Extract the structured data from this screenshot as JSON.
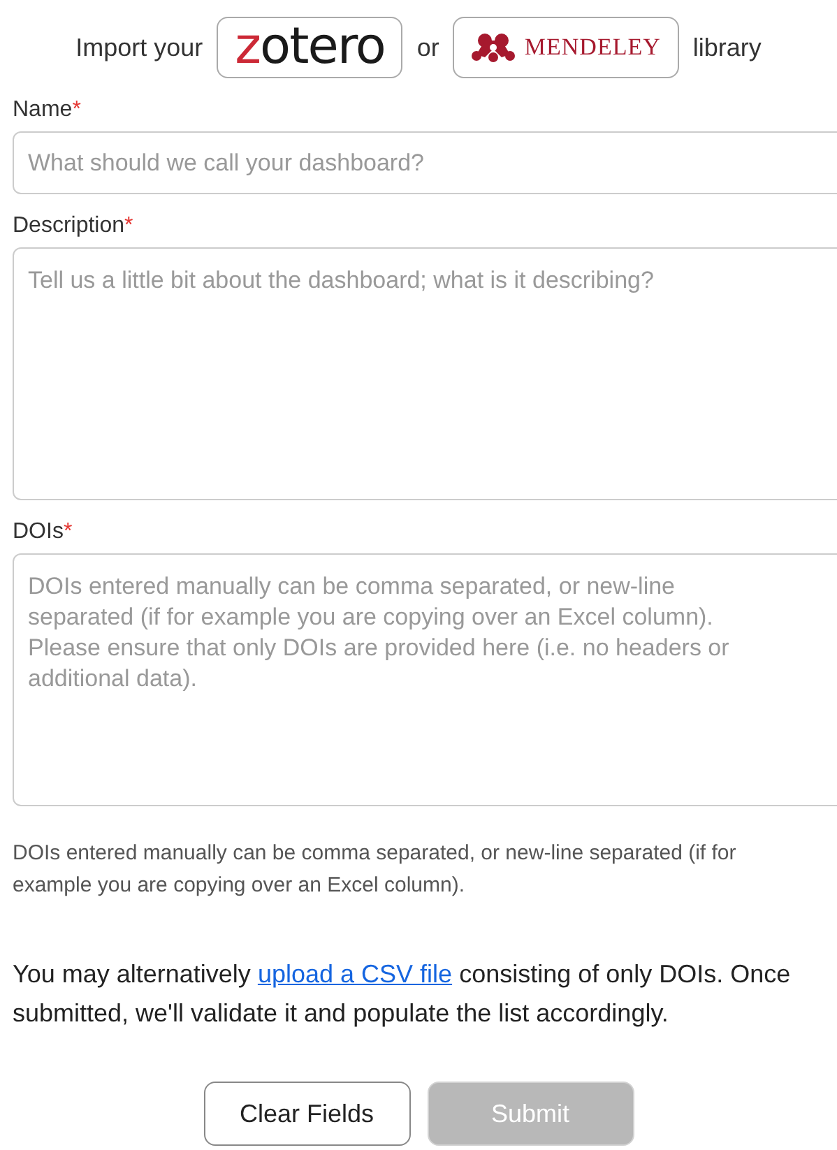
{
  "import_bar": {
    "prefix": "Import your",
    "zotero_logo": "zotero",
    "separator": "or",
    "mendeley_logo": "MENDELEY",
    "suffix": "library"
  },
  "fields": [
    {
      "label": "Name",
      "required": true,
      "required_marker": "*",
      "kind": "input",
      "placeholder": "What should we call your dashboard?"
    },
    {
      "label": "Description",
      "required": true,
      "required_marker": "*",
      "kind": "textarea",
      "placeholder": "Tell us a little bit about the dashboard; what is it describing?"
    },
    {
      "label": "DOIs",
      "required": true,
      "required_marker": "*",
      "kind": "textarea",
      "placeholder": "DOIs entered manually can be comma separated, or new-line separated (if for example you are copying over an Excel column). Please ensure that only DOIs are provided here (i.e. no headers or additional data)."
    }
  ],
  "help_text": "DOIs entered manually can be comma separated, or new-line separated (if for example you are copying over an Excel column).",
  "upload_note": {
    "before": "You may alternatively",
    "link": "upload a CSV file",
    "after": "consisting of only DOIs. Once submitted, we'll validate it and populate the list accordingly."
  },
  "buttons": [
    {
      "label": "Clear Fields",
      "disabled": false
    },
    {
      "label": "Submit",
      "disabled": true
    }
  ]
}
